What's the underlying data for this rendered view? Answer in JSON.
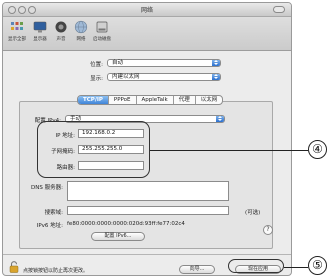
{
  "window": {
    "title": "网络"
  },
  "toolbar": {
    "items": [
      {
        "label": "显示全部",
        "icon": "grid-icon"
      },
      {
        "label": "显示器",
        "icon": "display-icon"
      },
      {
        "label": "声音",
        "icon": "speaker-icon"
      },
      {
        "label": "网络",
        "icon": "network-globe-icon"
      },
      {
        "label": "启动磁盘",
        "icon": "disk-icon"
      }
    ]
  },
  "location": {
    "label": "位置:",
    "value": "自动"
  },
  "show": {
    "label": "显示:",
    "value": "内建以太网"
  },
  "tabs": [
    "TCP/IP",
    "PPPoE",
    "AppleTalk",
    "代理",
    "以太网"
  ],
  "active_tab": "TCP/IP",
  "config_ipv4": {
    "label": "配置 IPv4:",
    "value": "手动"
  },
  "ip": {
    "label": "IP 地址:",
    "value": "192.168.0.2"
  },
  "subnet": {
    "label": "子网掩码:",
    "value": "255.255.255.0"
  },
  "router": {
    "label": "路由器:",
    "value": ""
  },
  "dns": {
    "label": "DNS 服务器:",
    "value": ""
  },
  "search_domains": {
    "label": "搜索域:",
    "value": "",
    "optional": "(可选)"
  },
  "ipv6": {
    "label": "IPv6 地址:",
    "value": "fe80:0000:0000:0000:020d:93ff:fe77:02c4"
  },
  "configure_ipv6_button": "配置 IPv6...",
  "help_label": "?",
  "lock_text": "点按锁按钮以防止再次更改。",
  "assistant_button": "向导...",
  "apply_button": "现在应用",
  "callouts": {
    "four": "④",
    "five": "⑤"
  }
}
